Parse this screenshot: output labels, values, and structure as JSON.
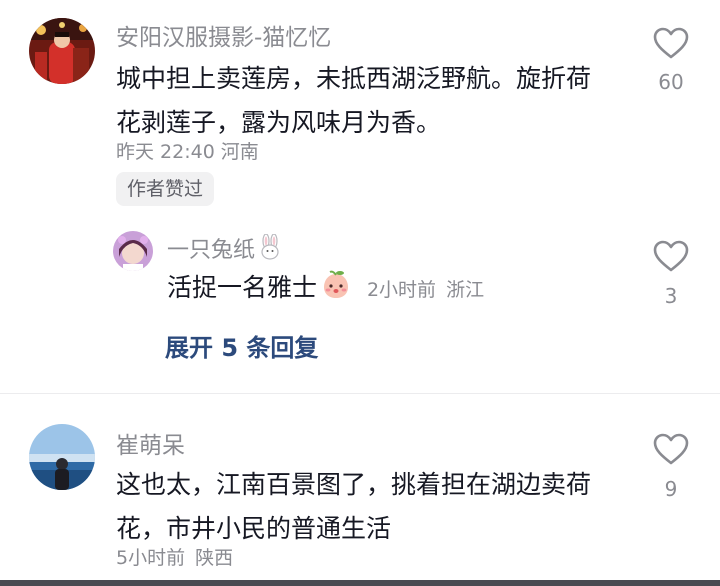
{
  "comments": [
    {
      "username": "安阳汉服摄影-猫忆忆",
      "text": "城中担上卖莲房，未抵西湖泛野航。旋折荷花剥莲子，露为风味月为香。",
      "time": "昨天 22:40",
      "location": "河南",
      "likes": "60",
      "badge": "作者赞过",
      "avatar_icon": "portrait-photo-red-hanfu"
    },
    {
      "username": "一只兔纸",
      "username_icon": "rabbit-emoji-icon",
      "text": "活捉一名雅士",
      "text_icon": "peach-face-emoji-icon",
      "time": "2小时前",
      "location": "浙江",
      "likes": "3",
      "avatar_icon": "portrait-girl-purple"
    },
    {
      "username": "崔萌呆",
      "text": "这也太，江南百景图了，挑着担在湖边卖荷花，市井小民的普通生活",
      "time": "5小时前",
      "location": "陕西",
      "likes": "9",
      "avatar_icon": "portrait-lake-sky"
    }
  ],
  "expand_replies": "展开 5 条回复",
  "colors": {
    "primary_text": "#161823",
    "secondary_text": "#8a8b91",
    "link": "#2c4a7c",
    "badge_bg": "#f1f1f2"
  }
}
